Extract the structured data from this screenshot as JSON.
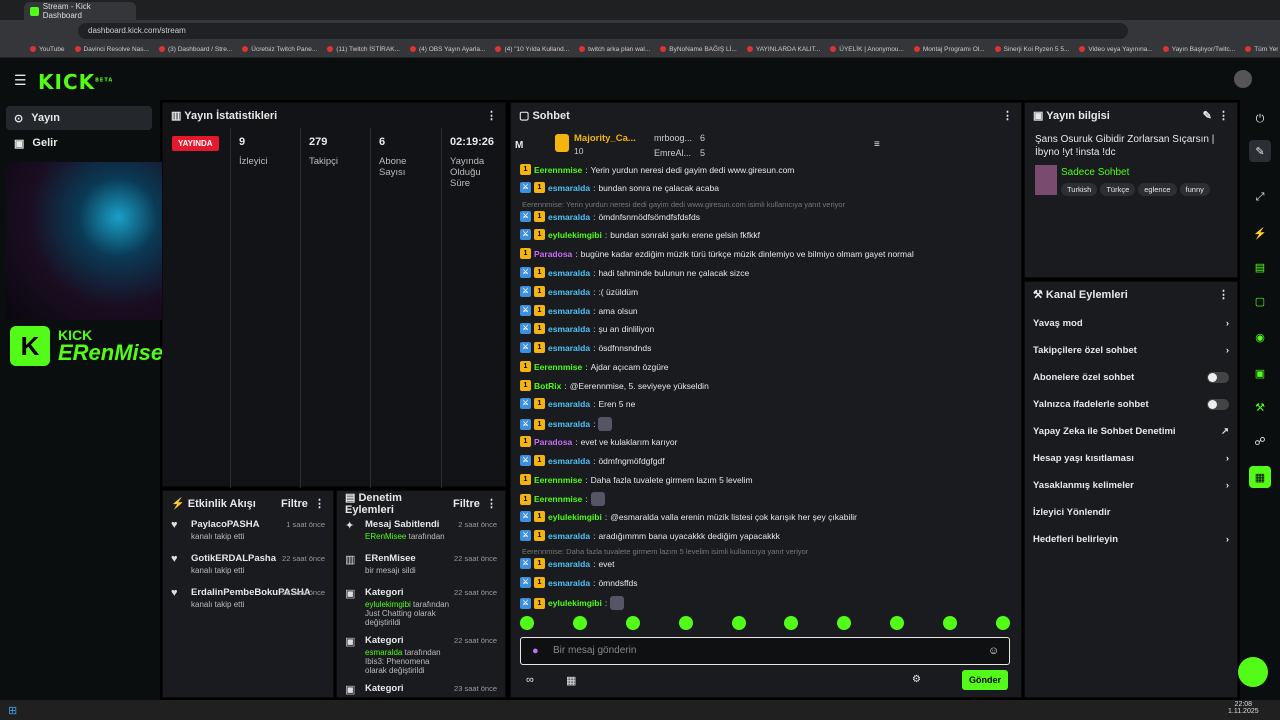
{
  "browser": {
    "tab_title": "Stream - Kick Dashboard",
    "url": "dashboard.kick.com/stream",
    "bookmarks": [
      "YouTube",
      "Davinci Resolve Nas...",
      "(3) Dashboard / Stre...",
      "Ücretsiz Twitch Pane...",
      "(11) Twitch İSTİRAK...",
      "(4) OBS Yayın Ayarla...",
      "(4) \"10 Yılda Kulland...",
      "twitch arka plan wal...",
      "ByNoName BAĞIŞ Lİ...",
      "YAYINLARDA KALIT...",
      "ÜYELİK | Anonymou...",
      "Montaj Programı Ol...",
      "Sinerji Koi Ryzen 5 5...",
      "Video veya Yayınına...",
      "Yayın Başlıyor/Twitc...",
      "Tüm Yer İşaretleri"
    ]
  },
  "brand": {
    "logo": "KICK",
    "beta": "BETA",
    "channel_brand": "KICK",
    "channel_name": "ERenMisee"
  },
  "nav": {
    "items": [
      {
        "label": "Yayın"
      },
      {
        "label": "Gelir"
      }
    ]
  },
  "stats": {
    "title": "Yayın İstatistikleri",
    "live": "YAYINDA",
    "viewers_value": "9",
    "viewers_label": "İzleyici",
    "followers_value": "279",
    "followers_label": "Takipçi",
    "subs_value": "6",
    "subs_label": "Abone Sayısı",
    "uptime_value": "02:19:26",
    "uptime_label": "Yayında Olduğu Süre"
  },
  "activity": {
    "title": "Etkinlik Akışı",
    "filter": "Filtre",
    "items": [
      {
        "user": "PaylacoPASHA",
        "text": "kanalı takip etti",
        "time": "1 saat önce"
      },
      {
        "user": "GotikERDALPasha",
        "text": "kanalı takip etti",
        "time": "22 saat önce"
      },
      {
        "user": "ErdalinPembeBokuPASHA",
        "text": "kanalı takip etti",
        "time": "22 saat önce"
      }
    ]
  },
  "mod": {
    "title": "Denetim Eylemleri",
    "filter": "Filtre",
    "items": [
      {
        "title": "Mesaj Sabitlendi",
        "actor": "ERenMisee",
        "text": "tarafından",
        "time": "2 saat önce"
      },
      {
        "title": "ERenMisee",
        "actor": "",
        "text": "bir mesajı sildi",
        "time": "22 saat önce"
      },
      {
        "title": "Kategori",
        "actor": "eylulekimgibi",
        "text": "tarafından Just Chatting olarak değiştirildi",
        "time": "22 saat önce"
      },
      {
        "title": "Kategori",
        "actor": "esmaralda",
        "text": "tarafından Ibis3: Phenomena olarak değiştirildi",
        "time": "22 saat önce"
      },
      {
        "title": "Kategori",
        "actor": "",
        "text": "",
        "time": "23 saat önce"
      }
    ]
  },
  "chat": {
    "title": "Sohbet",
    "top_letter": "M",
    "leader1": "Majority_Ca...",
    "leader1_count": "10",
    "leader2": "mrboog...",
    "leader2_count": "6",
    "leader3": "EmreAl...",
    "leader3_count": "5",
    "messages": [
      {
        "user": "Eerennmise",
        "color": "#53fc18",
        "text": "Yerin yurdun neresi dedi gayim dedi www.giresun.com"
      },
      {
        "user": "esmaralda",
        "color": "#4fc3f7",
        "text": "bundan sonra ne çalacak acaba"
      },
      {
        "user": "esmaralda",
        "color": "#4fc3f7",
        "text": "ömdnfsnmödfsömdfsfdsfds"
      },
      {
        "user": "eylulekimgibi",
        "color": "#53fc18",
        "text": "bundan sonraki şarkı erene gelsin fkfkkf"
      },
      {
        "user": "Paradosa",
        "color": "#c86bfa",
        "text": "bugüne kadar ezdiğim müzik türü türkçe müzik dinlemiyo ve bilmiyo olmam gayet normal"
      },
      {
        "user": "esmaralda",
        "color": "#4fc3f7",
        "text": "hadi tahminde bulunun ne çalacak sizce"
      },
      {
        "user": "esmaralda",
        "color": "#4fc3f7",
        "text": ":( üzüldüm"
      },
      {
        "user": "esmaralda",
        "color": "#4fc3f7",
        "text": "ama olsun"
      },
      {
        "user": "esmaralda",
        "color": "#4fc3f7",
        "text": "şu an dinliliyon"
      },
      {
        "user": "esmaralda",
        "color": "#4fc3f7",
        "text": "ösdfnnsndnds"
      },
      {
        "user": "Eerennmise",
        "color": "#53fc18",
        "text": "Ajdar açıcam özgüre"
      },
      {
        "user": "BotRix",
        "color": "#53fc18",
        "text": "@Eerennmise, 5. seviyeye yükseldin"
      },
      {
        "user": "esmaralda",
        "color": "#4fc3f7",
        "text": "Eren 5 ne"
      },
      {
        "user": "esmaralda",
        "color": "#4fc3f7",
        "text": ""
      },
      {
        "user": "Paradosa",
        "color": "#c86bfa",
        "text": "evet ve kulaklarım karıyor"
      },
      {
        "user": "esmaralda",
        "color": "#4fc3f7",
        "text": "ödmfngmöfdgfgdf"
      },
      {
        "user": "Eerennmise",
        "color": "#53fc18",
        "text": "Daha fazla tuvalete girmem lazım 5 levelim"
      },
      {
        "user": "Eerennmise",
        "color": "#53fc18",
        "text": ""
      },
      {
        "user": "eylulekimgibi",
        "color": "#53fc18",
        "text": "@esmaralda valla erenin müzik listesi çok karışık her şey çıkabilir"
      },
      {
        "user": "esmaralda",
        "color": "#4fc3f7",
        "text": "aradığımmm bana uyacakkk dediğim yapacakkk"
      },
      {
        "user": "esmaralda",
        "color": "#4fc3f7",
        "text": "evet"
      },
      {
        "user": "esmaralda",
        "color": "#4fc3f7",
        "text": "ömndsffds"
      },
      {
        "user": "eylulekimgibi",
        "color": "#53fc18",
        "text": ""
      }
    ],
    "reply1": "Eerennmise: Yerin yurdun neresi dedi gayim dedi www.giresun.com isimli kullanıcıya yanıt veriyor",
    "reply2": "Eerennmise: Daha fazla tuvalete girmem lazım 5 levelim isimli kullanıcıya yanıt veriyor",
    "placeholder": "Bir mesaj gönderin",
    "send": "Gönder"
  },
  "info": {
    "title": "Yayın bilgisi",
    "stream_title": "Şans Osuruk Gibidir Zorlarsan Sıçarsın | İbyno !yt !insta !dc",
    "mode": "Sadece Sohbet",
    "tags": [
      "Turkish",
      "Türkçe",
      "eglence",
      "funny"
    ]
  },
  "actions": {
    "title": "Kanal Eylemleri",
    "items": [
      {
        "label": "Yavaş mod",
        "kind": "arrow"
      },
      {
        "label": "Takipçilere özel sohbet",
        "kind": "arrow"
      },
      {
        "label": "Abonelere özel sohbet",
        "kind": "toggle"
      },
      {
        "label": "Yalnızca ifadelerle sohbet",
        "kind": "toggle"
      },
      {
        "label": "Yapay Zeka ile Sohbet Denetimi",
        "kind": "ext"
      },
      {
        "label": "Hesap yaşı kısıtlaması",
        "kind": "arrow"
      },
      {
        "label": "Yasaklanmış kelimeler",
        "kind": "arrow"
      },
      {
        "label": "İzleyici Yönlendir",
        "kind": "none"
      },
      {
        "label": "Hedefleri belirleyin",
        "kind": "arrow"
      }
    ]
  },
  "taskbar": {
    "time": "22:08",
    "date": "1.11.2025"
  },
  "colors": {
    "accent": "#53fc18",
    "live": "#e5192e",
    "panel": "#191b1f"
  }
}
